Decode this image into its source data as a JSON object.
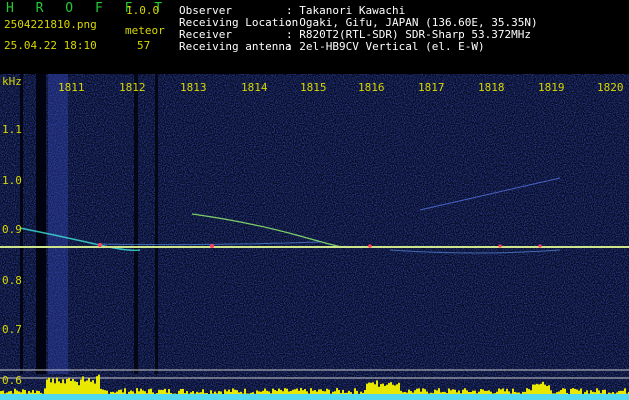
{
  "header": {
    "app_name": "H R O F F T",
    "version": "1.0.0",
    "filename": "2504221810.png",
    "mode": "meteor",
    "datetime": "25.04.22 18:10",
    "count": "57",
    "info": [
      {
        "key": "Observer",
        "value": ": Takanori Kawachi"
      },
      {
        "key": "Receiving Location",
        "value": ": Ogaki, Gifu, JAPAN (136.60E, 35.35N)"
      },
      {
        "key": "Receiver",
        "value": ": R820T2(RTL-SDR) SDR-Sharp 53.372MHz"
      },
      {
        "key": "Receiving antenna",
        "value": ": 2el-HB9CV Vertical (el. E-W)"
      }
    ]
  },
  "axis": {
    "y_unit": "kHz",
    "x_ticks": [
      "1811",
      "1812",
      "1813",
      "1814",
      "1815",
      "1816",
      "1817",
      "1818",
      "1819",
      "1820"
    ],
    "y_ticks": [
      "1.1",
      "1.0",
      "0.9",
      "0.8",
      "0.7",
      "0.6"
    ]
  },
  "colors": {
    "background": "#000000",
    "label_yellow": "#d8d800",
    "logo_green": "#22c933",
    "noise_blue": "#1a2a9a",
    "carrier": "#e0e060",
    "amplitude": "#e8e800"
  }
}
